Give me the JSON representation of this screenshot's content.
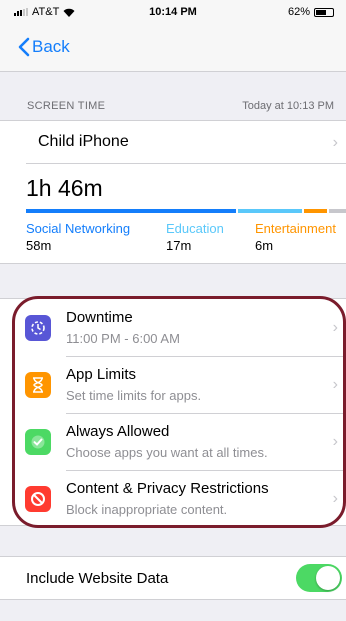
{
  "status": {
    "carrier": "AT&T",
    "time": "10:14 PM",
    "battery": "62%",
    "battery_level": 0.62
  },
  "nav": {
    "back_label": "Back"
  },
  "screen_time": {
    "header": "SCREEN TIME",
    "updated": "Today at 10:13 PM",
    "device": "Child iPhone",
    "total": "1h 46m",
    "categories": [
      {
        "name": "Social Networking",
        "time": "58m",
        "color": "#147efb"
      },
      {
        "name": "Education",
        "time": "17m",
        "color": "#5ac8fa"
      },
      {
        "name": "Entertainment",
        "time": "6m",
        "color": "#ff9500"
      }
    ]
  },
  "settings": [
    {
      "title": "Downtime",
      "subtitle": "11:00 PM - 6:00 AM",
      "icon": "downtime-icon",
      "color": "#5856d6"
    },
    {
      "title": "App Limits",
      "subtitle": "Set time limits for apps.",
      "icon": "hourglass-icon",
      "color": "#ff9500"
    },
    {
      "title": "Always Allowed",
      "subtitle": "Choose apps you want at all times.",
      "icon": "checkmark-icon",
      "color": "#4cd964"
    },
    {
      "title": "Content & Privacy Restrictions",
      "subtitle": "Block inappropriate content.",
      "icon": "restriction-icon",
      "color": "#ff3b30"
    }
  ],
  "website_data": {
    "label": "Include Website Data",
    "enabled": true
  }
}
